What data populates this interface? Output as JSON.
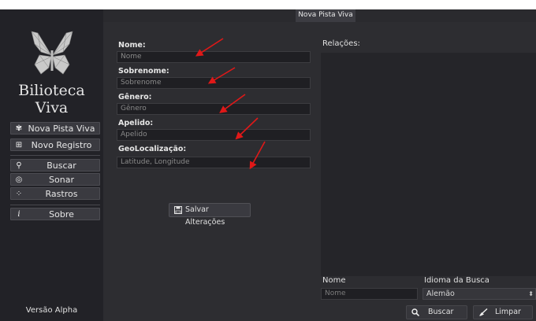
{
  "sidebar": {
    "app_title": "Bilioteca Viva",
    "nav": [
      {
        "label": "Nova Pista Viva",
        "icon": "footprints-icon"
      },
      {
        "label": "Novo Registro",
        "icon": "new-record-icon"
      },
      {
        "label": "Buscar",
        "icon": "search-icon"
      },
      {
        "label": "Sonar",
        "icon": "sonar-icon"
      },
      {
        "label": "Rastros",
        "icon": "tracks-icon"
      },
      {
        "label": "Sobre",
        "icon": "info-icon"
      }
    ],
    "version": "Versão Alpha"
  },
  "window": {
    "tab_title": "Nova Pista Viva"
  },
  "form": {
    "fields": [
      {
        "label": "Nome:",
        "placeholder": "Nome"
      },
      {
        "label": "Sobrenome:",
        "placeholder": "Sobrenome"
      },
      {
        "label": "Gênero:",
        "placeholder": "Gênero"
      },
      {
        "label": "Apelido:",
        "placeholder": "Apelido"
      },
      {
        "label": "GeoLocalização:",
        "placeholder": "Latitude, Longitude"
      }
    ],
    "save_label": "Salvar Alterações"
  },
  "relations": {
    "label": "Relações:",
    "nome_label": "Nome",
    "nome_placeholder": "Nome",
    "lang_label": "Idioma da Busca",
    "lang_value": "Alemão",
    "search_label": "Buscar",
    "clear_label": "Limpar"
  },
  "colors": {
    "annotation_arrow": "#e01818",
    "sidebar_bg": "#222227",
    "main_bg": "#2d2d31"
  }
}
